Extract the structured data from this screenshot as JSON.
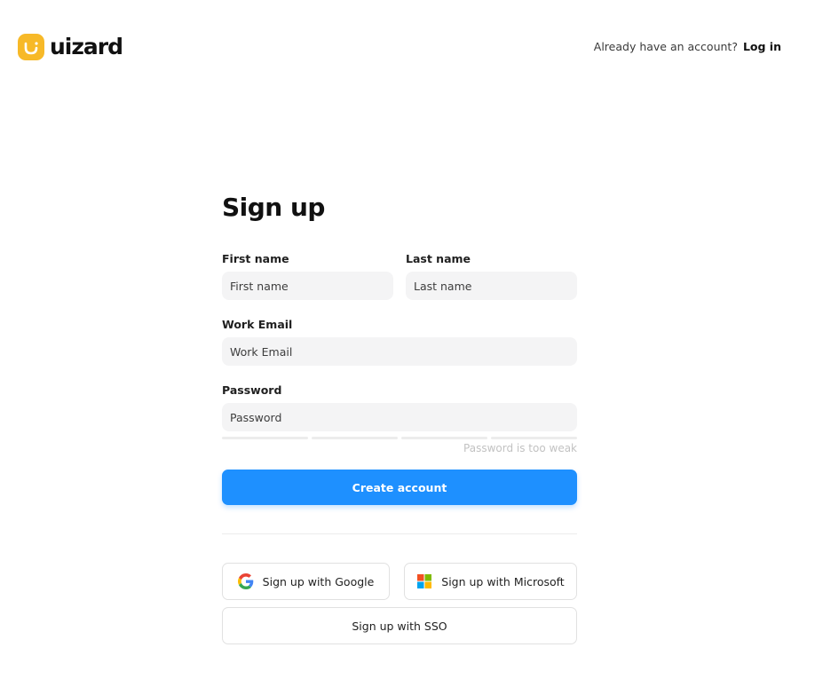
{
  "header": {
    "brand": "uizard",
    "login_prompt": "Already have an account?",
    "login_link": "Log in"
  },
  "form": {
    "title": "Sign up",
    "first_name": {
      "label": "First name",
      "placeholder": "First name"
    },
    "last_name": {
      "label": "Last name",
      "placeholder": "Last name"
    },
    "email": {
      "label": "Work Email",
      "placeholder": "Work Email"
    },
    "password": {
      "label": "Password",
      "placeholder": "Password",
      "strength_text": "Password is too weak",
      "strength_level": 0
    },
    "create_button": "Create account"
  },
  "social": {
    "google": "Sign up with Google",
    "microsoft": "Sign up with Microsoft",
    "sso": "Sign up with SSO"
  },
  "colors": {
    "brand_yellow": "#f7b928",
    "primary_blue": "#1e90ff",
    "input_bg": "#f4f4f5"
  },
  "icons": {
    "logo": "uizard-smile-logo-icon",
    "google": "google-icon",
    "microsoft": "microsoft-icon"
  }
}
